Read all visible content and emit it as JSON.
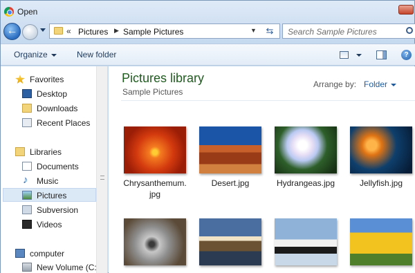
{
  "window": {
    "title": "Open",
    "close_label": ""
  },
  "address": {
    "overflow": "«",
    "crumbs": [
      "Pictures",
      "Sample Pictures"
    ],
    "refresh_icon": "refresh-icon"
  },
  "search": {
    "placeholder": "Search Sample Pictures"
  },
  "toolbar": {
    "organize": "Organize",
    "new_folder": "New folder"
  },
  "sidebar": {
    "favorites": "Favorites",
    "desktop": "Desktop",
    "downloads": "Downloads",
    "recent": "Recent Places",
    "libraries": "Libraries",
    "documents": "Documents",
    "music": "Music",
    "pictures": "Pictures",
    "subversion": "Subversion",
    "videos": "Videos",
    "computer": "computer",
    "new_volume": "New Volume (C:"
  },
  "main": {
    "title": "Pictures library",
    "subtitle": "Sample Pictures",
    "arrange_label": "Arrange by:",
    "arrange_value": "Folder",
    "files": [
      {
        "name": "Chrysanthemum.\njpg"
      },
      {
        "name": "Desert.jpg"
      },
      {
        "name": "Hydrangeas.jpg"
      },
      {
        "name": "Jellyfish.jpg"
      },
      {
        "name": ""
      },
      {
        "name": ""
      },
      {
        "name": ""
      },
      {
        "name": ""
      }
    ]
  }
}
